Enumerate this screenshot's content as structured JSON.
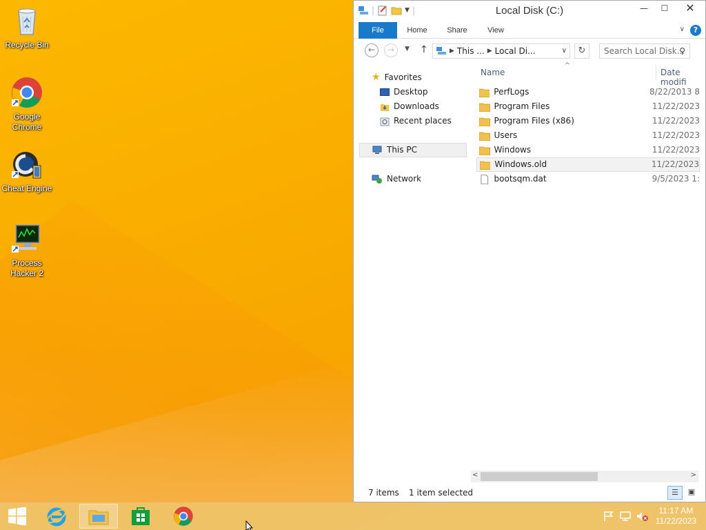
{
  "desktop": {
    "icons": [
      {
        "label": "Recycle Bin"
      },
      {
        "label": "Google Chrome"
      },
      {
        "label": "Cheat Engine"
      },
      {
        "label": "Process Hacker 2"
      }
    ]
  },
  "explorer": {
    "title": "Local Disk (C:)",
    "tabs": {
      "file": "File",
      "home": "Home",
      "share": "Share",
      "view": "View"
    },
    "breadcrumb": {
      "this_pc": "This ...",
      "local_disk": "Local Di..."
    },
    "search_placeholder": "Search Local Disk...",
    "nav": {
      "favorites": "Favorites",
      "desktop": "Desktop",
      "downloads": "Downloads",
      "recent": "Recent places",
      "this_pc": "This PC",
      "network": "Network"
    },
    "columns": {
      "name": "Name",
      "date": "Date modifi"
    },
    "files": [
      {
        "name": "PerfLogs",
        "date": "8/22/2013 8",
        "type": "folder"
      },
      {
        "name": "Program Files",
        "date": "11/22/2023",
        "type": "folder"
      },
      {
        "name": "Program Files (x86)",
        "date": "11/22/2023",
        "type": "folder"
      },
      {
        "name": "Users",
        "date": "11/22/2023",
        "type": "folder"
      },
      {
        "name": "Windows",
        "date": "11/22/2023",
        "type": "folder"
      },
      {
        "name": "Windows.old",
        "date": "11/22/2023",
        "type": "folder"
      },
      {
        "name": "bootsqm.dat",
        "date": "9/5/2023 1:",
        "type": "file"
      }
    ],
    "status": {
      "count": "7 items",
      "selected": "1 item selected"
    }
  },
  "taskbar": {
    "time": "11:17 AM",
    "date": "11/22/2023"
  },
  "colors": {
    "file_tab": "#1979ca",
    "accent": "#1979ca"
  }
}
